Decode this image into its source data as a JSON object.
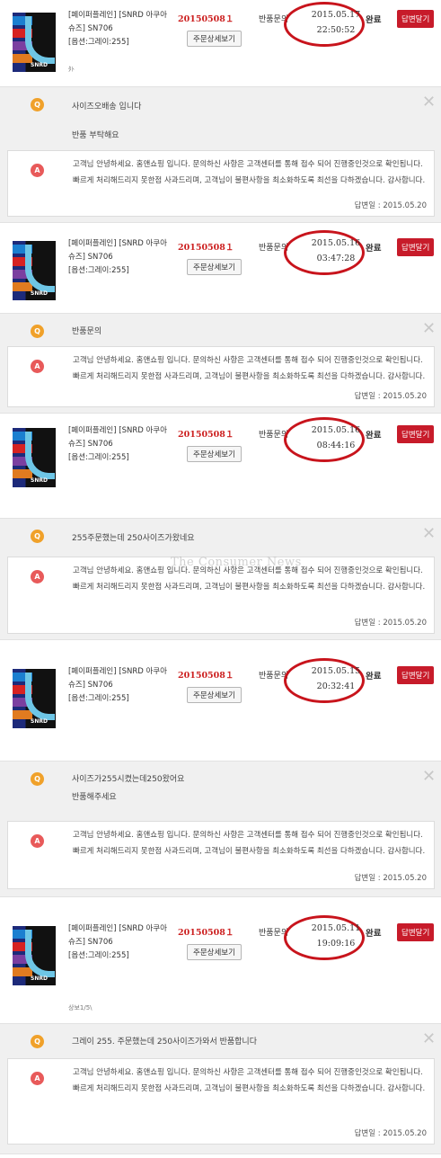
{
  "watermark": "The Consumer News",
  "orders": [
    {
      "product_lines": [
        "[페이퍼플레인] [SNRD 아쿠아",
        "슈즈] SN706",
        "[옵션:그레이:255]"
      ],
      "order_no": "20150508１",
      "detail_button": "주문상세보기",
      "request_type": "반품문의",
      "date": "2015.05.17",
      "time": "22:50:52",
      "status": "완료",
      "reply_button": "답변달기",
      "note": "ﾀﾄ",
      "question": [
        "사이즈오배송 입니다",
        "반품 부탁해요"
      ],
      "answer": [
        "고객님 안녕하세요. 홈앤쇼핑 입니다. 문의하신 사항은 고객센터를 통해 접수 되어 진행중인것으로 확인됩니다.",
        "빠르게 처리해드리지 못한점 사과드리며, 고객님이 불편사항을 최소화하도록 최선을 다하겠습니다. 감사합니다."
      ],
      "answer_date": "답변일 : 2015.05.20"
    },
    {
      "product_lines": [
        "[페이퍼플레인] [SNRD 아쿠아",
        "슈즈] SN706",
        "[옵션:그레이:255]"
      ],
      "order_no": "20150508１",
      "detail_button": "주문상세보기",
      "request_type": "반품문의",
      "date": "2015.05.16",
      "time": "03:47:28",
      "status": "완료",
      "reply_button": "답변달기",
      "note": "",
      "question": [
        "반품문의"
      ],
      "answer": [
        "고객님 안녕하세요. 홈앤쇼핑 입니다. 문의하신 사항은 고객센터를 통해 접수 되어 진행중인것으로 확인됩니다.",
        "빠르게 처리해드리지 못한점 사과드리며, 고객님이 불편사항을 최소화하도록 최선을 다하겠습니다. 감사합니다."
      ],
      "answer_date": "답변일 : 2015.05.20"
    },
    {
      "product_lines": [
        "[페이퍼플레인] [SNRD 아쿠아",
        "슈즈] SN706",
        "[옵션:그레이:255]"
      ],
      "order_no": "20150508１",
      "detail_button": "주문상세보기",
      "request_type": "반품문의",
      "date": "2015.05.16",
      "time": "08:44:16",
      "status": "완료",
      "reply_button": "답변달기",
      "note": "",
      "question": [
        "255주문했는데 250사이즈가왔네요"
      ],
      "answer": [
        "고객님 안녕하세요. 홈앤쇼핑 입니다. 문의하신 사항은 고객센터를 통해 접수 되어 진행중인것으로 확인됩니다.",
        "빠르게 처리해드리지 못한점 사과드리며, 고객님이 불편사항을 최소화하도록 최선을 다하겠습니다. 감사합니다."
      ],
      "answer_date": "답변일 : 2015.05.20"
    },
    {
      "product_lines": [
        "[페이퍼플레인] [SNRD 아쿠아",
        "슈즈] SN706",
        "[옵션:그레이:255]"
      ],
      "order_no": "20150508１",
      "detail_button": "주문상세보기",
      "request_type": "반품문의",
      "date": "2015.05.15",
      "time": "20:32:41",
      "status": "완료",
      "reply_button": "답변달기",
      "note": "",
      "question": [
        "사이즈가255시켰는데250왔어요",
        "반품해주세요"
      ],
      "answer": [
        "고객님 안녕하세요. 홈앤쇼핑 입니다. 문의하신 사항은 고객센터를 통해 접수 되어 진행중인것으로 확인됩니다.",
        "빠르게 처리해드리지 못한점 사과드리며, 고객님이 불편사항을 최소화하도록 최선을 다하겠습니다. 감사합니다."
      ],
      "answer_date": "답변일 : 2015.05.20"
    },
    {
      "product_lines": [
        "[페이퍼플레인] [SNRD 아쿠아",
        "슈즈] SN706",
        "[옵션:그레이:255]"
      ],
      "order_no": "20150508１",
      "detail_button": "주문상세보기",
      "request_type": "반품문의",
      "date": "2015.05.11",
      "time": "19:09:16",
      "status": "완료",
      "reply_button": "답변달기",
      "note": "상보1/5\\",
      "question": [
        "그레이 255. 주문했는데 250사이즈가와서 반품합니다"
      ],
      "answer": [
        "고객님 안녕하세요. 홈앤쇼핑 입니다. 문의하신 사항은 고객센터를 통해 접수 되어 진행중인것으로 확인됩니다.",
        "빠르게 처리해드리지 못한점 사과드리며, 고객님이 불편사항을 최소화하도록 최선을 다하겠습니다. 감사합니다."
      ],
      "answer_date": "답변일 : 2015.05.20"
    }
  ]
}
